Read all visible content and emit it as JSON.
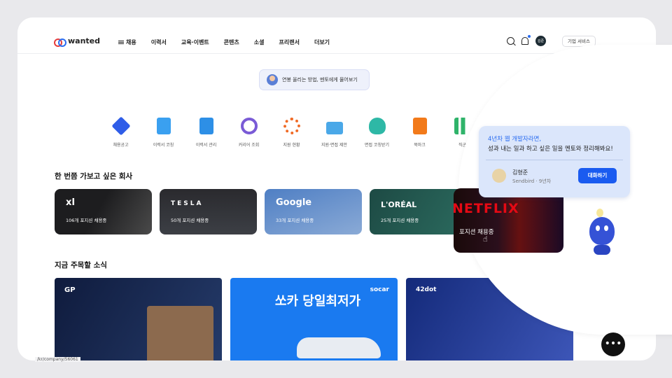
{
  "app": {
    "logo": "wanted"
  },
  "nav": {
    "items": [
      "채용",
      "이력서",
      "교육·이벤트",
      "콘텐츠",
      "소셜",
      "프리랜서",
      "더보기"
    ]
  },
  "header": {
    "avatar_text": "김준",
    "corp_service": "기업 서비스"
  },
  "banner": {
    "text": "연봉 올리는 방법, 멘토에게 물어보기"
  },
  "categories": [
    {
      "label": "채용공고",
      "color": "#2f5de8"
    },
    {
      "label": "이력서 코칭",
      "color": "#3aa0f0"
    },
    {
      "label": "이력서 관리",
      "color": "#2d8fe6"
    },
    {
      "label": "커리어 조회",
      "color": "#7a5bd6"
    },
    {
      "label": "지원 현황",
      "color": "#f06a25"
    },
    {
      "label": "지원·면접 제안",
      "color": "#4aa8e8"
    },
    {
      "label": "면접 코칭받기",
      "color": "#2eb8a6"
    },
    {
      "label": "북마크",
      "color": "#f27a1a"
    },
    {
      "label": "직군",
      "color": "#2fb36a"
    }
  ],
  "sections": {
    "companies_title": "한 번쯤 가보고 싶은 회사",
    "news_title": "지금 주목할 소식"
  },
  "companies": [
    {
      "name": "xI",
      "count": "106개 포지션 채용중",
      "bg": "#1d1d1f"
    },
    {
      "name": "TESLA",
      "count": "50개 포지션 채용중",
      "bg": "#2a2a2e"
    },
    {
      "name": "Google",
      "count": "33개 포지션 채용중",
      "bg": "#4f7fc4"
    },
    {
      "name": "L'ORÉAL",
      "count": "25개 포지션 채용중",
      "bg": "#1d4a44"
    }
  ],
  "netflix": {
    "name": "NETFLIX",
    "count": "포지션 채용중"
  },
  "news": [
    {
      "brand": "GP",
      "bg": "#0f1b3d"
    },
    {
      "brand": "socar",
      "headline": "쏘카 당일최저가",
      "bg": "#1a7af0"
    },
    {
      "brand": "42dot",
      "bg": "#142a7a"
    }
  ],
  "tooltip": {
    "line1": "4년차 웹 개발자라면,",
    "line2": "성과 내는 일과 하고 싶은 일을 멘토와 정리해봐요!",
    "mentor_name": "김형준",
    "mentor_sub": "Sendbird · 9년차",
    "button": "대화하기"
  },
  "status_url": "/kr/company/56061"
}
